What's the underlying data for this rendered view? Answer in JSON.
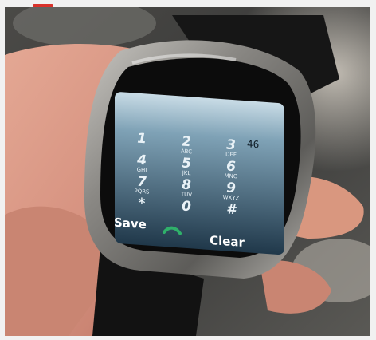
{
  "header": {
    "up_icon": "up-arrow-icon",
    "up_color": "#d9322b"
  },
  "photo": {
    "subject": "watch-phone-on-wrist",
    "screen": {
      "signal": "46",
      "keys": [
        {
          "digit": "1",
          "letters": ""
        },
        {
          "digit": "2",
          "letters": "ABC"
        },
        {
          "digit": "3",
          "letters": "DEF"
        },
        {
          "digit": "4",
          "letters": "GHI"
        },
        {
          "digit": "5",
          "letters": "JKL"
        },
        {
          "digit": "6",
          "letters": "MNO"
        },
        {
          "digit": "7",
          "letters": "PQRS"
        },
        {
          "digit": "8",
          "letters": "TUV"
        },
        {
          "digit": "9",
          "letters": "WXYZ"
        },
        {
          "digit": "*",
          "letters": ""
        },
        {
          "digit": "0",
          "letters": ""
        },
        {
          "digit": "#",
          "letters": ""
        }
      ],
      "soft_left": "Save",
      "soft_right": "Clear",
      "call_icon": "phone-handset-icon"
    }
  }
}
